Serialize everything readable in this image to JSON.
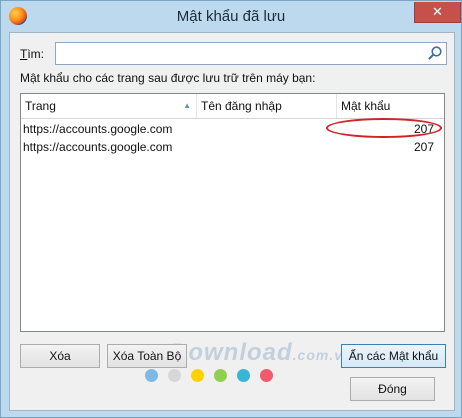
{
  "window": {
    "title": "Mật khẩu đã lưu",
    "close_glyph": "✕"
  },
  "search": {
    "label_underlined": "T",
    "label_rest": "ìm:",
    "value": "",
    "icon": "search-icon"
  },
  "info_text": "Mật khẩu cho các trang sau được lưu trữ trên máy bạn:",
  "table": {
    "columns": [
      "Trang",
      "Tên đăng nhập",
      "Mật khẩu"
    ],
    "sort_indicator": "▲",
    "rows": [
      {
        "site": "https://accounts.google.com",
        "username": "",
        "password": "207"
      },
      {
        "site": "https://accounts.google.com",
        "username": "",
        "password": "207"
      }
    ]
  },
  "buttons": {
    "delete": "Xóa",
    "delete_all": "Xóa Toàn Bộ",
    "show_passwords": "Ẩn các Mật khẩu",
    "close": "Đóng"
  },
  "watermark": {
    "main": "Download",
    "suffix": ".com.vn"
  },
  "colors": {
    "accent_red": "#d3222a",
    "dots": [
      "#7fb9e3",
      "#d7d7d7",
      "#ffd200",
      "#8fd14f",
      "#38b6d6",
      "#f05a6a"
    ]
  }
}
